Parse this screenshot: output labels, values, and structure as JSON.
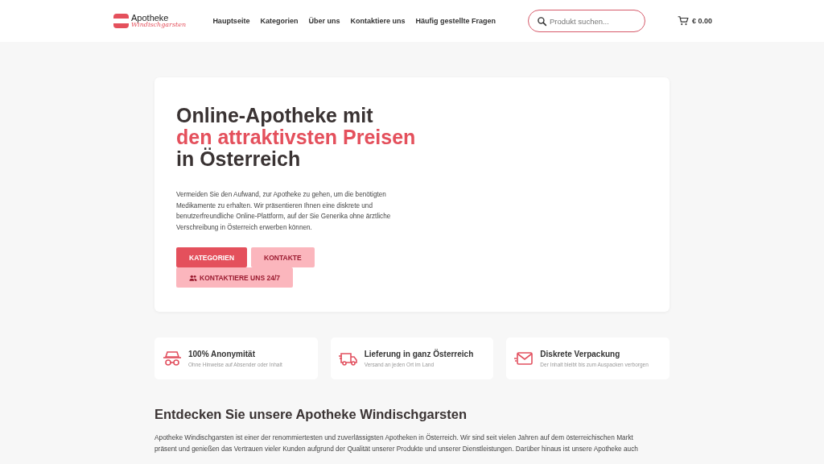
{
  "header": {
    "logo": {
      "line_1": "Apotheke",
      "line_2": "Windischgarsten"
    },
    "nav": [
      "Hauptseite",
      "Kategorien",
      "Über uns",
      "Kontaktiere uns",
      "Häufig gestellte Fragen"
    ],
    "search": {
      "placeholder": "Produkt suchen..."
    },
    "cart": {
      "total": "€ 0.00"
    }
  },
  "hero": {
    "title_lines": [
      {
        "text": "Online-Apotheke mit",
        "kind": "plain"
      },
      {
        "text": "den attraktivsten Preisen",
        "kind": "accent"
      },
      {
        "text": "in Österreich",
        "kind": "plain"
      }
    ],
    "text": "Vermeiden Sie den Aufwand, zur Apotheke zu gehen, um die benötigten Medikamente zu erhalten. Wir präsentieren Ihnen eine diskrete und benutzerfreundliche Online-Plattform, auf der Sie Generika ohne ärztliche Verschreibung in Österreich erwerben können.",
    "buttons": [
      {
        "label": "KATEGORIEN",
        "kind": "primary"
      },
      {
        "label": "KONTAKTE",
        "kind": "secondary"
      },
      {
        "label": "KONTAKTIERE UNS 24/7",
        "kind": "secondary-icon"
      }
    ]
  },
  "features": [
    {
      "kind": "incognito",
      "title": "100% Anonymität",
      "subtitle": "Ohne Hinweise auf Absender oder Inhalt"
    },
    {
      "kind": "truck",
      "title": "Lieferung in ganz Österreich",
      "subtitle": "Versand an jeden Ort im Land"
    },
    {
      "kind": "envelope",
      "title": "Diskrete Verpackung",
      "subtitle": "Der Inhalt bleibt bis zum Auspacken verborgen"
    }
  ],
  "about": {
    "title": "Entdecken Sie unsere Apotheke Windischgarsten",
    "text": "Apotheke Windischgarsten ist einer der renommiertesten und zuverlässigsten Apotheken in Österreich. Wir sind seit vielen Jahren auf dem österreichischen Markt präsent und genießen das Vertrauen vieler Kunden aufgrund der Qualität unserer Produkte und unserer Dienstleistungen. Darüber hinaus ist unsere Apotheke auch"
  }
}
